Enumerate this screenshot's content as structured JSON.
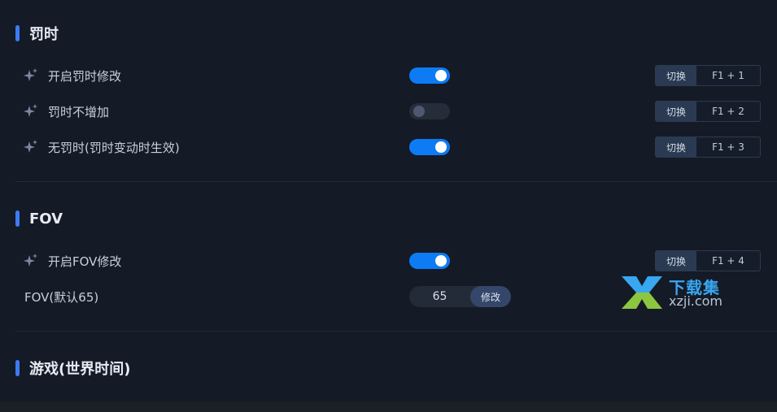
{
  "sections": [
    {
      "title": "罚时",
      "rows": [
        {
          "label": "开启罚时修改",
          "toggle": "on",
          "hotkey_action": "切换",
          "hotkey": "F1 + 1"
        },
        {
          "label": "罚时不增加",
          "toggle": "off",
          "hotkey_action": "切换",
          "hotkey": "F1 + 2"
        },
        {
          "label": "无罚时(罚时变动时生效)",
          "toggle": "on",
          "hotkey_action": "切换",
          "hotkey": "F1 + 3"
        }
      ]
    },
    {
      "title": "FOV",
      "rows": [
        {
          "label": "开启FOV修改",
          "toggle": "on",
          "hotkey_action": "切换",
          "hotkey": "F1 + 4"
        },
        {
          "label": "FOV(默认65)",
          "value": "65",
          "button": "修改"
        }
      ]
    },
    {
      "title": "游戏(世界时间)"
    }
  ],
  "watermark": {
    "top": "下载集",
    "bottom": "xzji.com"
  },
  "colors": {
    "accent": "#3b7cf5",
    "toggle_on": "#0d7bf3",
    "background": "#141a26"
  },
  "icons": {
    "option": "sparkle-icon",
    "watermark": "xzji-logo-icon"
  }
}
